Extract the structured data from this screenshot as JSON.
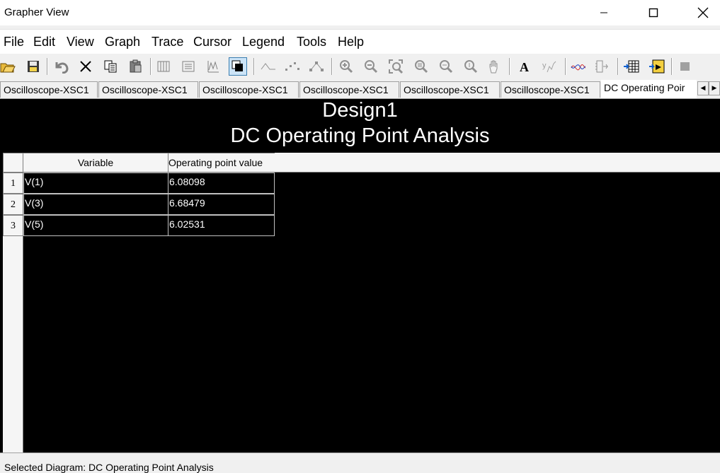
{
  "window": {
    "title": "Grapher View"
  },
  "menu": [
    "File",
    "Edit",
    "View",
    "Graph",
    "Trace",
    "Cursor",
    "Legend",
    "Tools",
    "Help"
  ],
  "tabs": [
    "Oscilloscope-XSC1",
    "Oscilloscope-XSC1",
    "Oscilloscope-XSC1",
    "Oscilloscope-XSC1",
    "Oscilloscope-XSC1",
    "Oscilloscope-XSC1",
    "DC Operating Poir"
  ],
  "graph": {
    "title": "Design1",
    "subtitle": "DC Operating Point Analysis",
    "columns": [
      "Variable",
      "Operating point value"
    ],
    "rows": [
      {
        "index": "1",
        "variable": "V(1)",
        "value": "6.08098"
      },
      {
        "index": "2",
        "variable": "V(3)",
        "value": "6.68479"
      },
      {
        "index": "3",
        "variable": "V(5)",
        "value": "6.02531"
      }
    ]
  },
  "status": {
    "text": "Selected Diagram: DC Operating Point Analysis"
  },
  "colors": {
    "graph_bg": "#000000",
    "graph_text": "#ffffff",
    "active_tool": "#cce4f7"
  }
}
